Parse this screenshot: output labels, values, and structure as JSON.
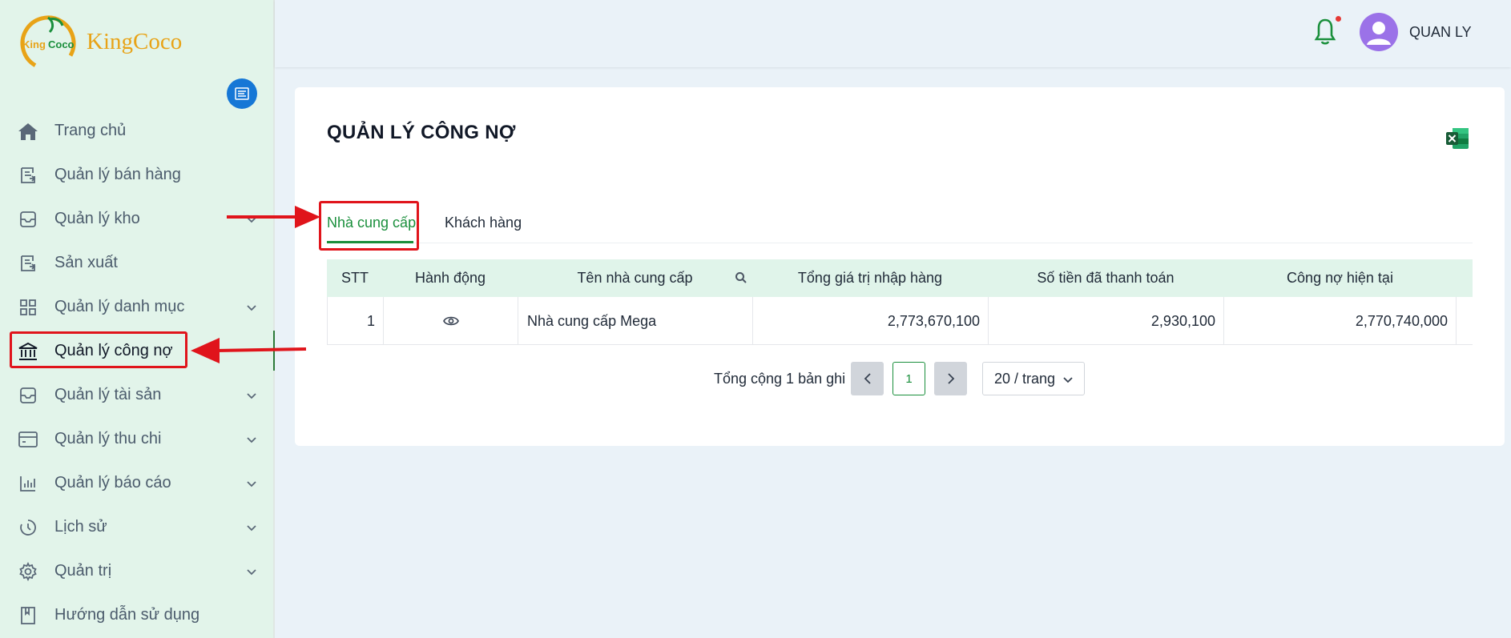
{
  "app": {
    "brand_name": "KingCoco",
    "logo_text": "KingCoco"
  },
  "sidebar": {
    "items": [
      {
        "label": "Trang chủ",
        "icon": "home-icon",
        "has_submenu": false
      },
      {
        "label": "Quản lý bán hàng",
        "icon": "receipt-icon",
        "has_submenu": false
      },
      {
        "label": "Quản lý kho",
        "icon": "inbox-icon",
        "has_submenu": true
      },
      {
        "label": "Sản xuất",
        "icon": "receipt-icon",
        "has_submenu": false
      },
      {
        "label": "Quản lý danh mục",
        "icon": "grid-icon",
        "has_submenu": true
      },
      {
        "label": "Quản lý công nợ",
        "icon": "bank-icon",
        "has_submenu": false,
        "active": true
      },
      {
        "label": "Quản lý tài sản",
        "icon": "inbox-icon",
        "has_submenu": true
      },
      {
        "label": "Quản lý thu chi",
        "icon": "wallet-icon",
        "has_submenu": true
      },
      {
        "label": "Quản lý báo cáo",
        "icon": "bar-chart-icon",
        "has_submenu": true
      },
      {
        "label": "Lịch sử",
        "icon": "history-icon",
        "has_submenu": true
      },
      {
        "label": "Quản trị",
        "icon": "gear-icon",
        "has_submenu": true
      },
      {
        "label": "Hướng dẫn sử dụng",
        "icon": "book-icon",
        "has_submenu": false
      }
    ]
  },
  "header": {
    "username": "QUAN LY",
    "has_notification": true
  },
  "page": {
    "title": "QUẢN LÝ CÔNG NỢ",
    "tabs": [
      {
        "label": "Nhà cung cấp",
        "active": true
      },
      {
        "label": "Khách hàng",
        "active": false
      }
    ]
  },
  "table": {
    "columns": [
      "STT",
      "Hành động",
      "Tên nhà cung cấp",
      "Tổng giá trị nhập hàng",
      "Số tiền đã thanh toán",
      "Công nợ hiện tại"
    ],
    "rows": [
      {
        "stt": "1",
        "name": "Nhà cung cấp Mega",
        "total_import": "2,773,670,100",
        "paid": "2,930,100",
        "debt": "2,770,740,000"
      }
    ]
  },
  "pagination": {
    "total_text": "Tổng cộng 1 bản ghi",
    "current_page": "1",
    "page_size": "20 / trang"
  },
  "colors": {
    "accent": "#1a8f3c",
    "sidebar_bg": "#e2f4ea",
    "annotation": "#e0141b",
    "primary_button": "#1677d6"
  }
}
